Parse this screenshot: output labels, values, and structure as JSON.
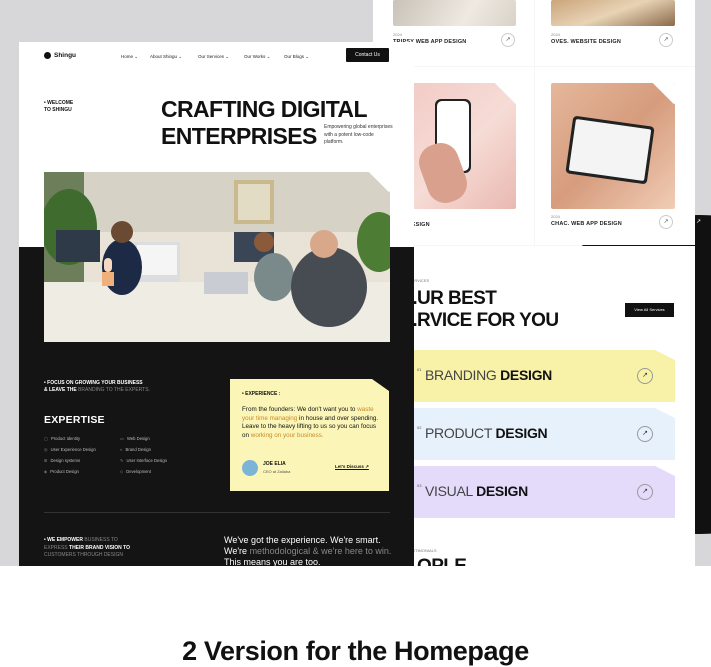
{
  "back": {
    "projects": [
      {
        "year": "2024",
        "title": "TRIPSY WEB APP DESIGN",
        "arrow": "↗"
      },
      {
        "year": "2024",
        "title": "OVES. WEBSITE DESIGN",
        "arrow": "↗"
      },
      {
        "year": "2024",
        "title": "...PP DESIGN",
        "arrow": "↗"
      },
      {
        "year": "2024",
        "title": "CHAC. WEB APP DESIGN",
        "arrow": "↗"
      }
    ],
    "services_kicker": "...RVICES",
    "services_title_line1": "...UR BEST",
    "services_title_line2": "...RVICE FOR YOU",
    "view_all": "View All Services",
    "services": [
      {
        "num": "01",
        "light": "BRANDING ",
        "bold": "DESIGN",
        "arrow": "↗",
        "color": "#f7f2a8"
      },
      {
        "num": "02",
        "light": "PRODUCT ",
        "bold": "DESIGN",
        "arrow": "↗",
        "color": "#e6f1fb"
      },
      {
        "num": "03",
        "light": "VISUAL ",
        "bold": "DESIGN",
        "arrow": "↗",
        "color": "#e4dbfb"
      }
    ],
    "testimonials_kicker": "...STIMONIALS",
    "testimonials_title": "...OPLE"
  },
  "front": {
    "logo": "Shingu",
    "nav": [
      "Home ⌄",
      "About Shingu ⌄",
      "Our Services ⌄",
      "Our Works ⌄",
      "Our Blogs ⌄"
    ],
    "contact": "Contact Us",
    "welcome_line1": "• WELCOME",
    "welcome_line2": "TO SHINGU",
    "hero_line1": "CRAFTING DIGITAL",
    "hero_line2": "ENTERPRISES",
    "hero_sub": "Empowering global enterprises with a potent low-code platform.",
    "focus_line1": "• FOCUS ON GROWING YOUR BUSINESS",
    "focus_line2_bold": "& LEAVE THE ",
    "focus_line2_light": "BRANDING TO THE EXPERTS.",
    "expertise_title": "EXPERTISE",
    "expertise_left": [
      "Product Identity",
      "User Experience Design",
      "Design systems",
      "Product Design"
    ],
    "expertise_right": [
      "Web Design",
      "Brand Design",
      "User Interface Design",
      "Development"
    ],
    "experience": {
      "label": "• EXPERIENCE :",
      "quote_a": "From the founders: We don't want you to ",
      "quote_b": "waste your time managing",
      "quote_c": " in house and over spending. Leave to the heavy lifting to us so you can focus on ",
      "quote_d": "working on your business.",
      "name": "JOE ELIA",
      "role": "CEO at Zallaba",
      "link": "Let's Discuss ↗"
    },
    "empower_line1_bold": "• WE EMPOWER ",
    "empower_line1_light": "BUSINESS TO",
    "empower_line2_light": "EXPRESS ",
    "empower_line2_bold": "THEIR BRAND VISION TO",
    "empower_line3": "CUSTOMERS THROUGH DESIGN",
    "big_a": "We've got the experience. We're smart. We're ",
    "big_b": "methodological & we're here to win.",
    "big_c": " This means you are too."
  },
  "caption": "2 Version for the Homepage"
}
